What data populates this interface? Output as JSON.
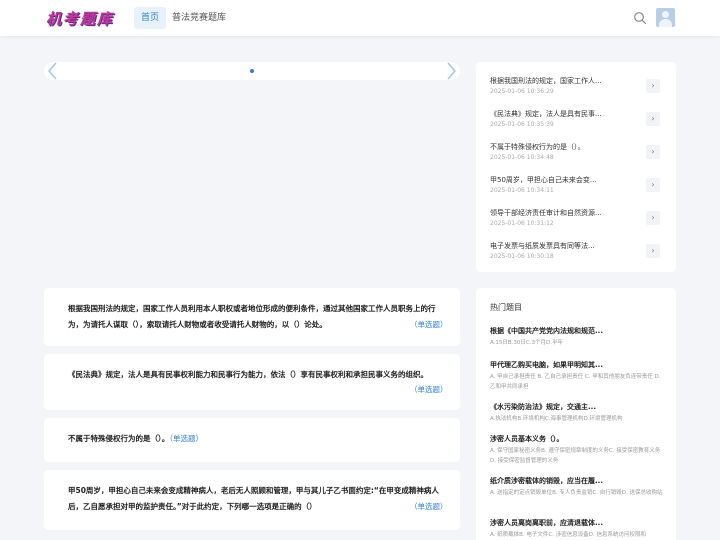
{
  "header": {
    "logo": "机考题库",
    "nav": {
      "home": "首页",
      "contest": "普法竞赛题库"
    },
    "search_icon": "search-icon",
    "avatar_icon": "user-avatar-icon"
  },
  "carousel": {
    "prev_icon": "chevron-left-icon",
    "next_icon": "chevron-right-icon"
  },
  "latest": {
    "items": [
      {
        "title": "根据我国刑法的规定，国家工作人...",
        "time": "2025-01-06 10:36:29"
      },
      {
        "title": "《民法典》规定，法人是具有民事...",
        "time": "2025-01-06 10:35:39"
      },
      {
        "title": "不属于特殊侵权行为的是（）。",
        "time": "2025-01-06 10:34:48"
      },
      {
        "title": "甲50周岁，甲担心自己未来会变...",
        "time": "2025-01-06 10:34:11"
      },
      {
        "title": "领导干部经济责任审计和自然资源...",
        "time": "2025-01-06 10:31:12"
      },
      {
        "title": "电子发票与纸质发票具有同等法...",
        "time": "2025-01-06 10:30:18"
      }
    ],
    "go_label": "›"
  },
  "questions": [
    {
      "line1": "根据我国刑法的规定，国家工作人员利用本人职权或者地位形成的便利条件，通过其他国家工作人员职务上的行",
      "line2": "为，为请托人谋取（），索取请托人财物或者收受请托人财物的，以（）论处。",
      "tag": "（单选题）"
    },
    {
      "line1": "《民法典》规定，法人是具有民事权利能力和民事行为能力，依法（）享有民事权利和承担民事义务的组织。",
      "tag": "（单选题）"
    },
    {
      "line1": "不属于特殊侵权行为的是（）。",
      "tag": "（单选题）"
    },
    {
      "line1": "甲50周岁，甲担心自己未来会变成精神病人，老后无人照顾和管理，甲与其儿子乙书面约定:“在甲变成精神病人",
      "line2": "后，乙自愿承担对甲的监护责任。”对于此约定，下列哪一选项是正确的（）",
      "tag": "（单选题）"
    }
  ],
  "hot": {
    "heading": "热门题目",
    "items": [
      {
        "title": "根据《中国共产党党内法规和规范...",
        "options": "A.15日B.30日C.3个月D.半年"
      },
      {
        "title": "甲代理乙购买电脑，如果甲明知其...",
        "options": "A. 甲自己承担责任 B. 乙自己承担责任 C. 甲和其他朋友负连带责任 D. 乙和甲共同承担"
      },
      {
        "title": "《水污染防治法》规定，交通主...",
        "options": "A.执法机构B.环境机构C.海事管理机构D.环境管理机构"
      },
      {
        "title": "涉密人员基本义务（）。",
        "options": "A. 保守国家秘密义务B. 遵守保密规章制度的义务C. 接受保密教育义务D. 接受保密监督管理的义务"
      },
      {
        "title": "纸介质涉密载体的销毁，应当在履...",
        "options": "A. 送指定的定点销毁单位B. 专人负责监销C. 自行销毁D. 送保总收购站"
      },
      {
        "title": "涉密人员离岗离职前，应清退载体...",
        "options": "A. 纸质载体B. 电子文件C. 涉密信息设备D. 信息系统访问权限和"
      }
    ]
  }
}
